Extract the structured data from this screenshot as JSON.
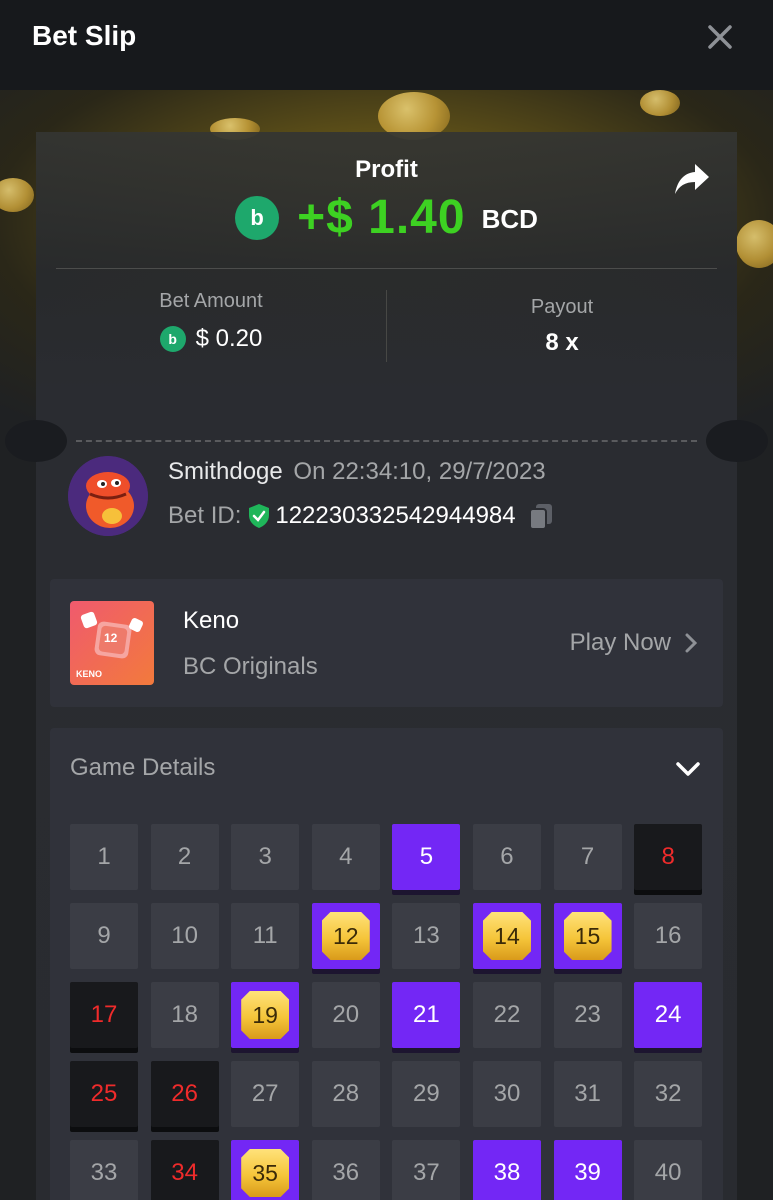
{
  "header": {
    "title": "Bet Slip"
  },
  "profit": {
    "label": "Profit",
    "value": "+$ 1.40",
    "currency": "BCD",
    "coin_glyph": "b",
    "accent": "#3dd122"
  },
  "bet": {
    "amount_label": "Bet Amount",
    "amount_value": "$ 0.20",
    "payout_label": "Payout",
    "payout_value": "8 x"
  },
  "user": {
    "name": "Smithdoge",
    "timestamp": "On 22:34:10, 29/7/2023",
    "bet_id_label": "Bet ID:",
    "bet_id": "122230332542944984"
  },
  "game": {
    "name": "Keno",
    "provider": "BC Originals",
    "play_label": "Play Now",
    "thumb_text": "KENO",
    "thumb_number": "12"
  },
  "details": {
    "title": "Game Details",
    "cells": [
      {
        "n": "1",
        "state": "none"
      },
      {
        "n": "2",
        "state": "none"
      },
      {
        "n": "3",
        "state": "none"
      },
      {
        "n": "4",
        "state": "none"
      },
      {
        "n": "5",
        "state": "picked"
      },
      {
        "n": "6",
        "state": "none"
      },
      {
        "n": "7",
        "state": "none"
      },
      {
        "n": "8",
        "state": "miss"
      },
      {
        "n": "9",
        "state": "none"
      },
      {
        "n": "10",
        "state": "none"
      },
      {
        "n": "11",
        "state": "none"
      },
      {
        "n": "12",
        "state": "hit"
      },
      {
        "n": "13",
        "state": "none"
      },
      {
        "n": "14",
        "state": "hit"
      },
      {
        "n": "15",
        "state": "hit"
      },
      {
        "n": "16",
        "state": "none"
      },
      {
        "n": "17",
        "state": "miss"
      },
      {
        "n": "18",
        "state": "none"
      },
      {
        "n": "19",
        "state": "hit"
      },
      {
        "n": "20",
        "state": "none"
      },
      {
        "n": "21",
        "state": "picked"
      },
      {
        "n": "22",
        "state": "none"
      },
      {
        "n": "23",
        "state": "none"
      },
      {
        "n": "24",
        "state": "picked"
      },
      {
        "n": "25",
        "state": "miss"
      },
      {
        "n": "26",
        "state": "miss"
      },
      {
        "n": "27",
        "state": "none"
      },
      {
        "n": "28",
        "state": "none"
      },
      {
        "n": "29",
        "state": "none"
      },
      {
        "n": "30",
        "state": "none"
      },
      {
        "n": "31",
        "state": "none"
      },
      {
        "n": "32",
        "state": "none"
      },
      {
        "n": "33",
        "state": "none"
      },
      {
        "n": "34",
        "state": "miss"
      },
      {
        "n": "35",
        "state": "hit"
      },
      {
        "n": "36",
        "state": "none"
      },
      {
        "n": "37",
        "state": "none"
      },
      {
        "n": "38",
        "state": "picked"
      },
      {
        "n": "39",
        "state": "picked"
      },
      {
        "n": "40",
        "state": "none"
      }
    ]
  },
  "colors": {
    "picked": "#7327f5",
    "miss_text": "#ef2b2b",
    "gem": "#f5c53a",
    "bc_green": "#1ea86c"
  },
  "icons": [
    "close-icon",
    "share-icon",
    "bc-coin-icon",
    "verified-shield-icon",
    "copy-icon",
    "chevron-right-icon",
    "chevron-down-icon"
  ]
}
